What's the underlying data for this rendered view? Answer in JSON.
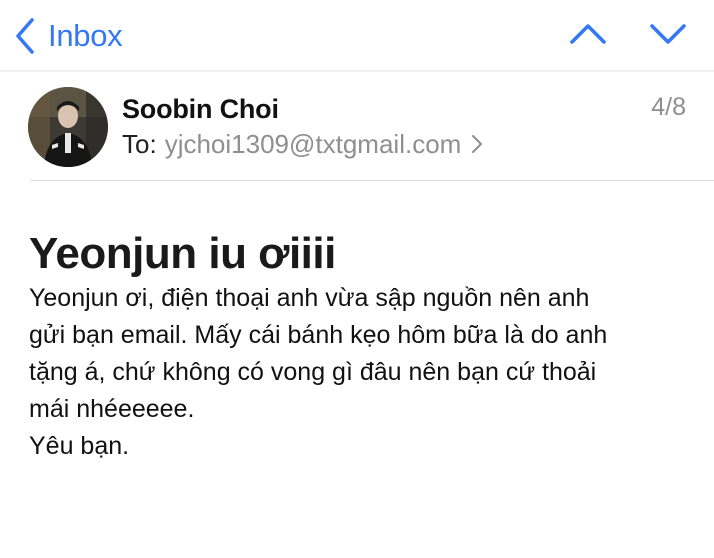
{
  "navbar": {
    "back_label": "Inbox",
    "back_icon": "chevron-left-icon",
    "prev_icon": "chevron-up-icon",
    "next_icon": "chevron-down-icon",
    "accent_color": "#3478f6"
  },
  "message": {
    "sender_name": "Soobin Choi",
    "to_label": "To:",
    "to_address": "yjchoi1309@txtgmail.com",
    "position_text": "4/8",
    "subject": "Yeonjun iu ơiiii",
    "body_lines": [
      "Yeonjun ơi, điện thoại anh vừa sập nguồn nên anh\ngửi bạn email. Mấy cái bánh kẹo hôm bữa là do anh\ntặng á, chứ không có vong gì đâu nên bạn cứ thoải\nmái nhéeeeee.",
      "Yêu bạn."
    ]
  }
}
